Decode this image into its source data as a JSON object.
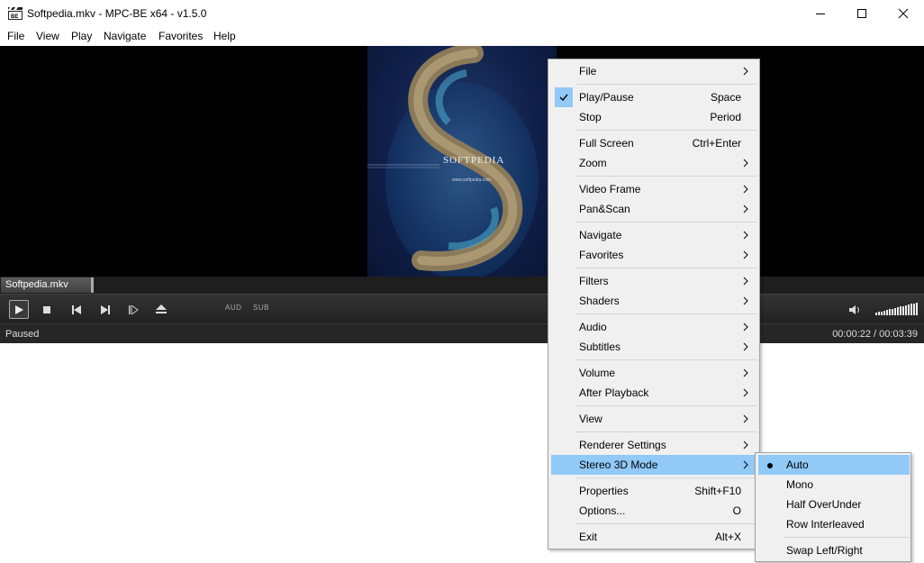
{
  "window": {
    "title": "Softpedia.mkv - MPC-BE x64 - v1.5.0",
    "icon": "clapperboard-icon"
  },
  "menubar": {
    "items": [
      "File",
      "View",
      "Play",
      "Navigate",
      "Favorites",
      "Help"
    ]
  },
  "video": {
    "watermark": "SOFTPEDIA",
    "watermark_url": "www.softpedia.com"
  },
  "playlist": {
    "active_tab": "Softpedia.mkv"
  },
  "controls": {
    "audio_label": "AUD",
    "subtitle_label": "SUB",
    "volume_level": 1.0
  },
  "status": {
    "state": "Paused",
    "time": "00:00:22 / 00:03:39"
  },
  "context_menu": {
    "items": [
      {
        "label": "File",
        "submenu": true
      },
      {
        "label": "Play/Pause",
        "shortcut": "Space",
        "checked": true
      },
      {
        "label": "Stop",
        "shortcut": "Period"
      },
      {
        "label": "Full Screen",
        "shortcut": "Ctrl+Enter"
      },
      {
        "label": "Zoom",
        "submenu": true
      },
      {
        "label": "Video Frame",
        "submenu": true
      },
      {
        "label": "Pan&Scan",
        "submenu": true
      },
      {
        "label": "Navigate",
        "submenu": true
      },
      {
        "label": "Favorites",
        "submenu": true
      },
      {
        "label": "Filters",
        "submenu": true
      },
      {
        "label": "Shaders",
        "submenu": true
      },
      {
        "label": "Audio",
        "submenu": true
      },
      {
        "label": "Subtitles",
        "submenu": true
      },
      {
        "label": "Volume",
        "submenu": true
      },
      {
        "label": "After Playback",
        "submenu": true
      },
      {
        "label": "View",
        "submenu": true
      },
      {
        "label": "Renderer Settings",
        "submenu": true
      },
      {
        "label": "Stereo 3D Mode",
        "submenu": true,
        "highlighted": true
      },
      {
        "label": "Properties",
        "shortcut": "Shift+F10"
      },
      {
        "label": "Options...",
        "shortcut": "O"
      },
      {
        "label": "Exit",
        "shortcut": "Alt+X"
      }
    ]
  },
  "stereo_submenu": {
    "items": [
      {
        "label": "Auto",
        "selected": true,
        "highlighted": true
      },
      {
        "label": "Mono"
      },
      {
        "label": "Half OverUnder"
      },
      {
        "label": "Row Interleaved"
      },
      {
        "label": "Swap Left/Right"
      }
    ]
  },
  "colors": {
    "menu_highlight": "#91c9f7",
    "menu_background": "#f0f0f0",
    "player_chrome": "#262626"
  }
}
